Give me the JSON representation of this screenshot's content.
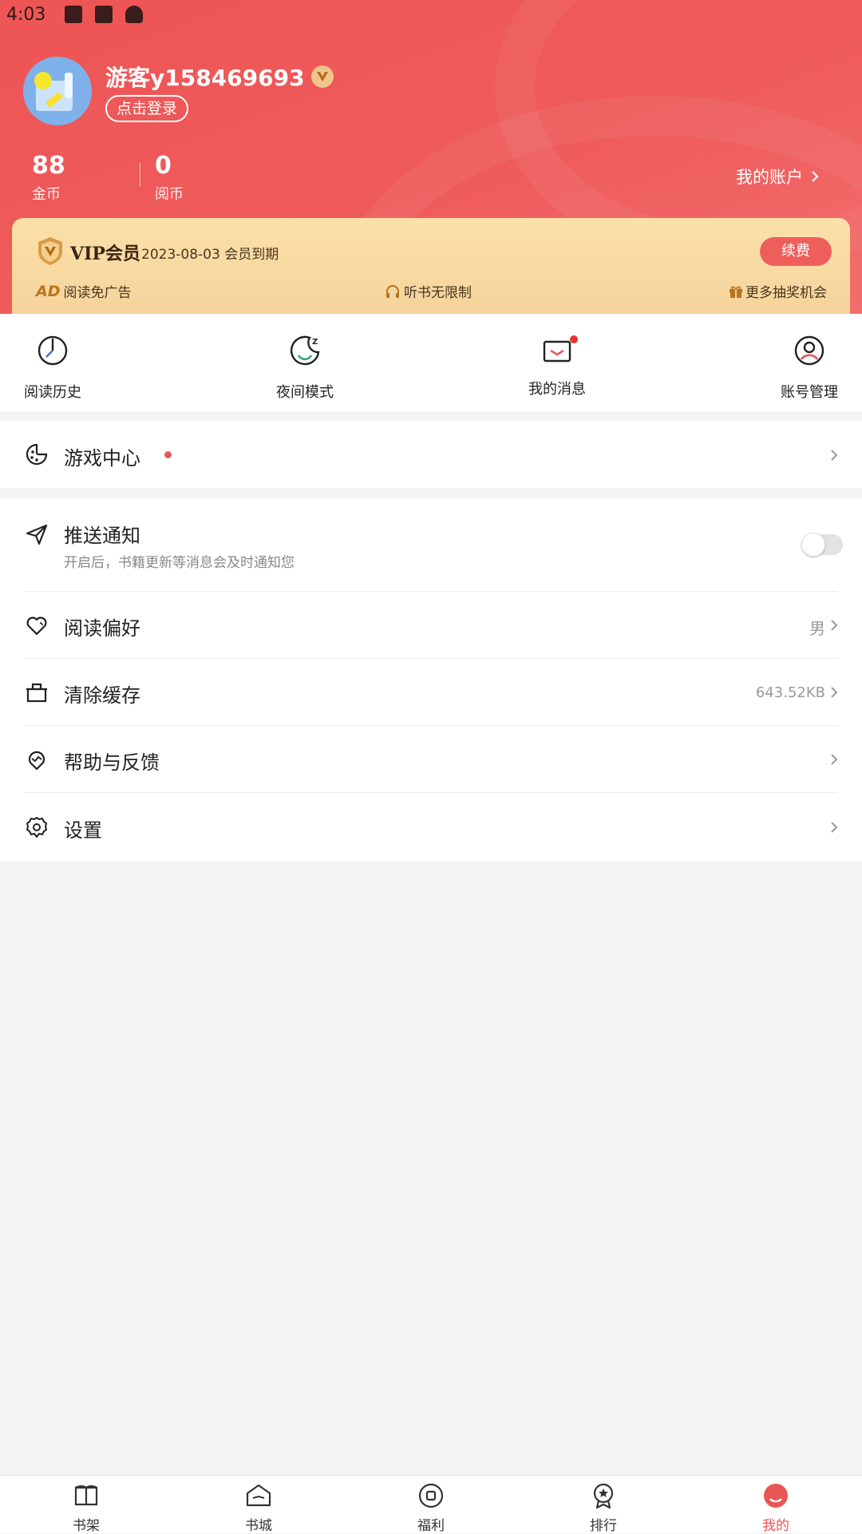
{
  "status_bar": {
    "time": "4:03"
  },
  "profile": {
    "username": "游客y158469693",
    "login_label": "点击登录",
    "coins_value": "88",
    "coins_label": "金币",
    "read_coins_value": "0",
    "read_coins_label": "阅币",
    "account_link": "我的账户"
  },
  "vip": {
    "title": "VIP会员",
    "expire": "2023-08-03 会员到期",
    "renew_label": "续费",
    "perks": [
      {
        "icon": "ad-icon",
        "label": "阅读免广告"
      },
      {
        "icon": "headphones-icon",
        "label": "听书无限制"
      },
      {
        "icon": "gift-icon",
        "label": "更多抽奖机会"
      }
    ]
  },
  "quick_actions": [
    {
      "icon": "history-icon",
      "label": "阅读历史"
    },
    {
      "icon": "night-mode-icon",
      "label": "夜间模式"
    },
    {
      "icon": "message-icon",
      "label": "我的消息",
      "has_dot": true
    },
    {
      "icon": "account-manage-icon",
      "label": "账号管理"
    }
  ],
  "game_center": {
    "icon": "game-icon",
    "label": "游戏中心"
  },
  "settings_list": [
    {
      "icon": "push-icon",
      "label": "推送通知",
      "sub": "开启后，书籍更新等消息会及时通知您",
      "toggle": false
    },
    {
      "icon": "heart-icon",
      "label": "阅读偏好",
      "value": "男"
    },
    {
      "icon": "clear-cache-icon",
      "label": "清除缓存",
      "value": "643.52KB"
    },
    {
      "icon": "help-icon",
      "label": "帮助与反馈"
    },
    {
      "icon": "settings-icon",
      "label": "设置"
    }
  ],
  "tabs": [
    {
      "icon": "bookshelf-icon",
      "label": "书架"
    },
    {
      "icon": "bookstore-icon",
      "label": "书城"
    },
    {
      "icon": "welfare-icon",
      "label": "福利"
    },
    {
      "icon": "ranking-icon",
      "label": "排行"
    },
    {
      "icon": "mine-icon",
      "label": "我的",
      "active": true
    }
  ],
  "colors": {
    "brand_red": "#ee5555",
    "vip_gold": "#f5d39b",
    "active_tab": "#e85656"
  }
}
